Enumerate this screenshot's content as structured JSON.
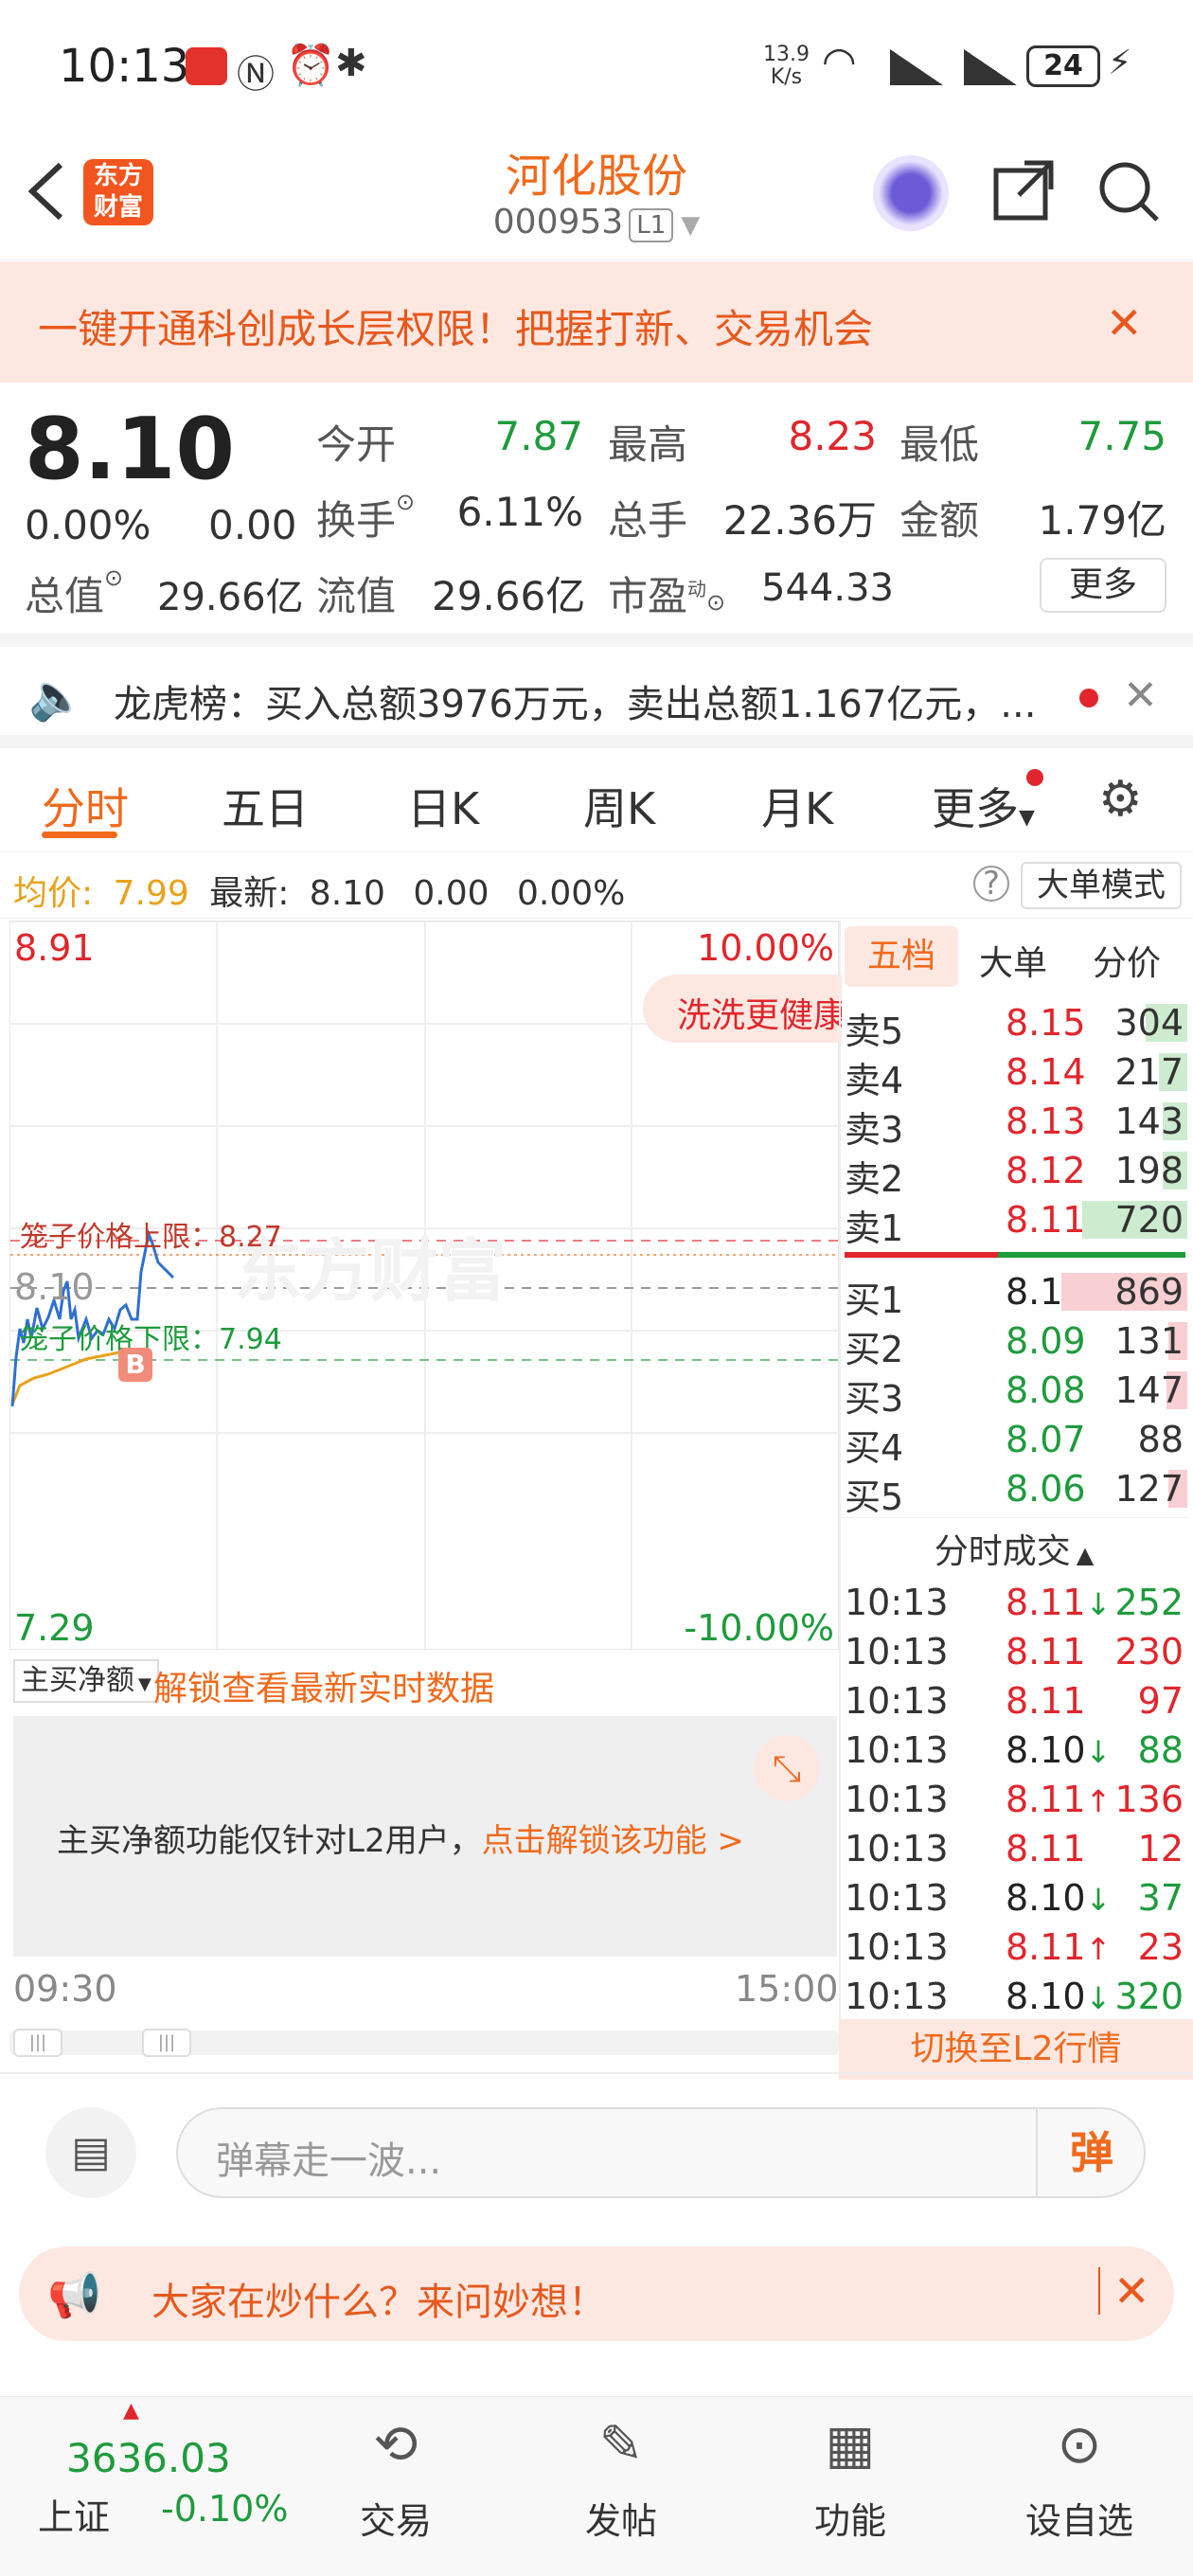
{
  "status_bar": {
    "time": "10:13",
    "net_speed_top": "13.9",
    "net_speed_bottom": "K/s",
    "battery": "24"
  },
  "header": {
    "logo_line1": "东方",
    "logo_line2": "财富",
    "title": "河化股份",
    "code": "000953",
    "level": "L1"
  },
  "banner": {
    "text": "一键开通科创成长层权限！把握打新、交易机会"
  },
  "quote": {
    "price": "8.10",
    "change_pct": "0.00%",
    "change": "0.00",
    "open_label": "今开",
    "open": "7.87",
    "high_label": "最高",
    "high": "8.23",
    "low_label": "最低",
    "low": "7.75",
    "turnover_label": "换手",
    "turnover": "6.11%",
    "volume_label": "总手",
    "volume": "22.36万",
    "amount_label": "金额",
    "amount": "1.79亿",
    "mktcap_label": "总值",
    "mktcap": "29.66亿",
    "float_label": "流值",
    "float": "29.66亿",
    "pe_label": "市盈",
    "pe_sup": "动",
    "pe": "544.33",
    "more": "更多"
  },
  "dragon": {
    "text": "龙虎榜：买入总额3976万元，卖出总额1.167亿元，..."
  },
  "tabs": [
    {
      "label": "分时"
    },
    {
      "label": "五日"
    },
    {
      "label": "日K"
    },
    {
      "label": "周K"
    },
    {
      "label": "月K"
    },
    {
      "label": "更多"
    }
  ],
  "avg": {
    "avg_label": "均价:",
    "avg_value": "7.99",
    "latest_label": "最新:",
    "latest_value": "8.10",
    "chg": "0.00",
    "chg_pct": "0.00%",
    "mode_btn": "大单模式"
  },
  "chart": {
    "top_price": "8.91",
    "top_pct": "10.00%",
    "bottom_price": "7.29",
    "bottom_pct": "-10.00%",
    "mid_price": "8.10",
    "upper_limit": "笼子价格上限：8.27",
    "lower_limit": "笼子价格下限：7.94",
    "badge": "B",
    "promo": "洗洗更健康",
    "watermark": "东方财富",
    "time_start": "09:30",
    "time_end": "15:00",
    "sub_selector": "主买净额",
    "unlock_text": "解锁查看最新实时数据",
    "l2_notice": "主买净额功能仅针对L2用户，",
    "l2_link": "点击解锁该功能 >"
  },
  "orderbook": {
    "tabs": [
      "五档",
      "大单",
      "分价"
    ],
    "asks": [
      {
        "label": "卖5",
        "price": "8.15",
        "vol": "304",
        "frac": 0.12
      },
      {
        "label": "卖4",
        "price": "8.14",
        "vol": "217",
        "frac": 0.08
      },
      {
        "label": "卖3",
        "price": "8.13",
        "vol": "143",
        "frac": 0.05
      },
      {
        "label": "卖2",
        "price": "8.12",
        "vol": "198",
        "frac": 0.07
      },
      {
        "label": "卖1",
        "price": "8.11",
        "vol": "720",
        "frac": 0.3
      }
    ],
    "bids": [
      {
        "label": "买1",
        "price": "8.10",
        "vol": "869",
        "frac": 0.36
      },
      {
        "label": "买2",
        "price": "8.09",
        "vol": "131",
        "frac": 0.05
      },
      {
        "label": "买3",
        "price": "8.08",
        "vol": "147",
        "frac": 0.06
      },
      {
        "label": "买4",
        "price": "8.07",
        "vol": "88",
        "frac": 0.0
      },
      {
        "label": "买5",
        "price": "8.06",
        "vol": "127",
        "frac": 0.05
      }
    ],
    "trades_header": "分时成交",
    "trades": [
      {
        "time": "10:13",
        "price": "8.11",
        "dir": "↓",
        "vol": "252",
        "pc": "red",
        "vc": "green"
      },
      {
        "time": "10:13",
        "price": "8.11",
        "dir": "",
        "vol": "230",
        "pc": "red",
        "vc": "red"
      },
      {
        "time": "10:13",
        "price": "8.11",
        "dir": "",
        "vol": "97",
        "pc": "red",
        "vc": "red"
      },
      {
        "time": "10:13",
        "price": "8.10",
        "dir": "↓",
        "vol": "88",
        "pc": "dark",
        "vc": "green"
      },
      {
        "time": "10:13",
        "price": "8.11",
        "dir": "↑",
        "vol": "136",
        "pc": "red",
        "vc": "red"
      },
      {
        "time": "10:13",
        "price": "8.11",
        "dir": "",
        "vol": "12",
        "pc": "red",
        "vc": "red"
      },
      {
        "time": "10:13",
        "price": "8.10",
        "dir": "↓",
        "vol": "37",
        "pc": "dark",
        "vc": "green"
      },
      {
        "time": "10:13",
        "price": "8.11",
        "dir": "↑",
        "vol": "23",
        "pc": "red",
        "vc": "red"
      },
      {
        "time": "10:13",
        "price": "8.10",
        "dir": "↓",
        "vol": "320",
        "pc": "dark",
        "vc": "green"
      }
    ],
    "switch_l2": "切换至L2行情"
  },
  "danmu": {
    "placeholder": "弹幕走一波...",
    "btn": "弹"
  },
  "ask": {
    "text": "大家在炒什么？来问妙想！"
  },
  "bottom_nav": {
    "index_value": "3636.03",
    "index_name": "上证",
    "index_chg": "-0.10%",
    "items": [
      {
        "label": "交易"
      },
      {
        "label": "发帖"
      },
      {
        "label": "功能"
      },
      {
        "label": "设自选"
      }
    ]
  },
  "colors": {
    "accent": "#f06a1c",
    "up": "#e0262c",
    "down": "#1e9b3c"
  }
}
